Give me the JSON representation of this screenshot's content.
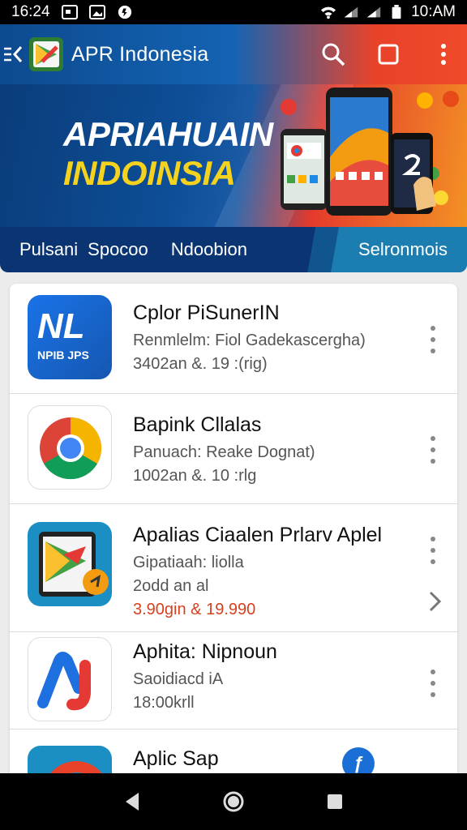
{
  "status_bar": {
    "time": "16:24",
    "clock_right": "10:AM",
    "icons_left": [
      "gallery-icon",
      "photo-icon",
      "settings-circle-icon"
    ],
    "icons_right": [
      "wifi-icon",
      "signal-icon",
      "signal-icon",
      "battery-icon"
    ]
  },
  "app_bar": {
    "title": "APR Indonesia",
    "nav_icon": "menu-back-icon",
    "actions": [
      "search-icon",
      "square-icon",
      "more-vert-icon"
    ]
  },
  "banner": {
    "headline_1": "APRIAHUAIN",
    "headline_2": "INDOINSIA"
  },
  "categories": [
    "Pulsani",
    "Spocoo",
    "Ndoobion",
    "Selronmois"
  ],
  "apps": [
    {
      "title": "Cplor PiSunerIN",
      "line2": "Renmlelm: Fiol Gadekascergha)",
      "line3": "3402an &. 19 :(rig)",
      "icon": "nl-app-icon",
      "icon_text_1": "NL",
      "icon_text_2": "NPIB JPS"
    },
    {
      "title": "Bapink Cllalas",
      "line2": "Panuach: Reake Dognat)",
      "line3": "1002an &. 10 :rlg",
      "icon": "chrome-icon"
    },
    {
      "title": "Apalias Ciaalen Prlarv Aplel",
      "line2": "Gipatiaah: liolla",
      "line3": "2odd an al",
      "price": "3.90gin & 19.990",
      "icon": "tablet-play-icon"
    },
    {
      "title": "Aphita: Nipnoun",
      "line2": "Saoidiacd iA",
      "line3": "18:00krll",
      "icon": "aj-logo-icon"
    },
    {
      "title": "Aplic Sap",
      "icon": "circle-app-icon"
    }
  ],
  "colors": {
    "appbar_blue": "#0d4a8f",
    "appbar_red": "#f04a2a",
    "banner_yellow": "#f4d21e",
    "price_orange": "#d5411e",
    "category_bg": "#0b3572"
  },
  "nav_bar": [
    "back-triangle-icon",
    "home-circle-icon",
    "recents-square-icon"
  ]
}
